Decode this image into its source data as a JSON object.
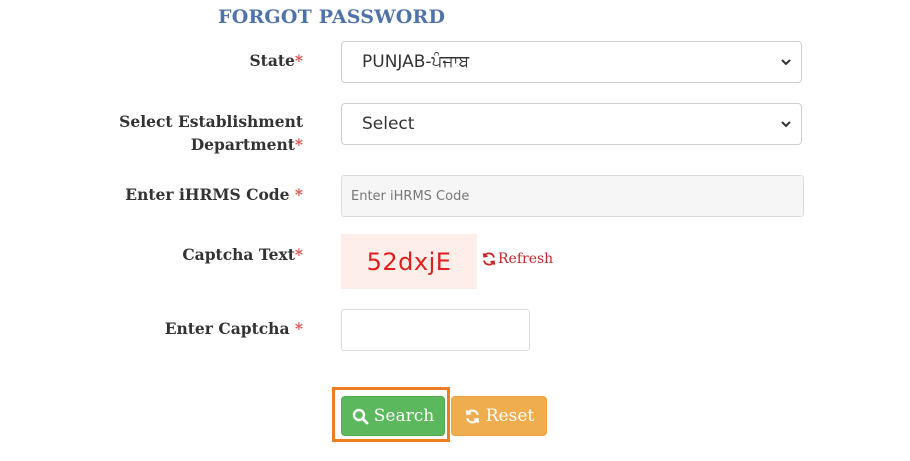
{
  "form": {
    "title": "FORGOT PASSWORD",
    "required_mark": "*",
    "state": {
      "label": "State",
      "value": "PUNJAB-ਪੰਜਾਬ"
    },
    "establishment": {
      "label_line1": "Select Establishment",
      "label_line2": "Department",
      "value": "Select"
    },
    "ihrms": {
      "label": "Enter iHRMS Code",
      "placeholder": "Enter iHRMS Code"
    },
    "captcha": {
      "label": "Captcha Text",
      "text": "52dxjE",
      "refresh_label": "Refresh"
    },
    "enter_captcha": {
      "label": "Enter Captcha",
      "value": ""
    },
    "buttons": {
      "search_label": "Search",
      "reset_label": "Reset"
    }
  },
  "colors": {
    "title": "#4f72a8",
    "required": "#d9534f",
    "search_button": "#5cb85c",
    "reset_button": "#f0ad4e",
    "focus_outline": "#f07d22",
    "captcha_text": "#e02020"
  }
}
